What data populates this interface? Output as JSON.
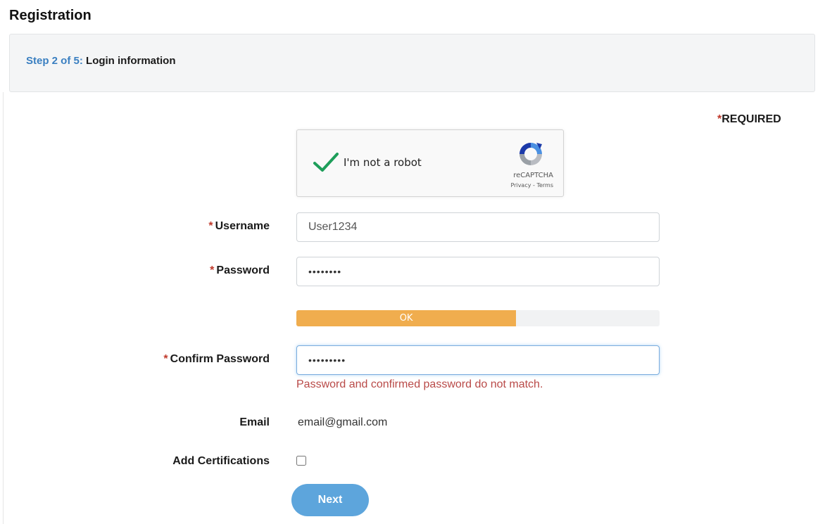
{
  "page": {
    "title": "Registration"
  },
  "step": {
    "prefix": "Step 2 of 5:",
    "name": "Login information"
  },
  "required_note": {
    "star": "*",
    "text": "REQUIRED"
  },
  "captcha": {
    "label": "I'm not a robot",
    "brand": "reCAPTCHA",
    "links": "Privacy - Terms",
    "checked": true,
    "check_color": "#1e9e5a"
  },
  "fields": {
    "username": {
      "star": "*",
      "label": "Username",
      "value": "User1234"
    },
    "password": {
      "star": "*",
      "label": "Password",
      "value": "••••••••"
    },
    "strength": {
      "label": "OK",
      "level_percent": 60.5,
      "color": "#f0ad4e"
    },
    "confirm_password": {
      "star": "*",
      "label": "Confirm Password",
      "value": "•••••••••",
      "error": "Password and confirmed password do not match."
    },
    "email": {
      "label": "Email",
      "value": "email@gmail.com"
    },
    "certifications": {
      "label": "Add Certifications",
      "checked": false
    }
  },
  "actions": {
    "next_label": "Next"
  },
  "colors": {
    "accent_link": "#3a7fc1",
    "required_star": "#c0392b",
    "error": "#b94a48",
    "button": "#5da5dc"
  },
  "icons": {
    "captcha_check": "check-mark-icon",
    "captcha_logo": "recaptcha-logo-icon"
  }
}
